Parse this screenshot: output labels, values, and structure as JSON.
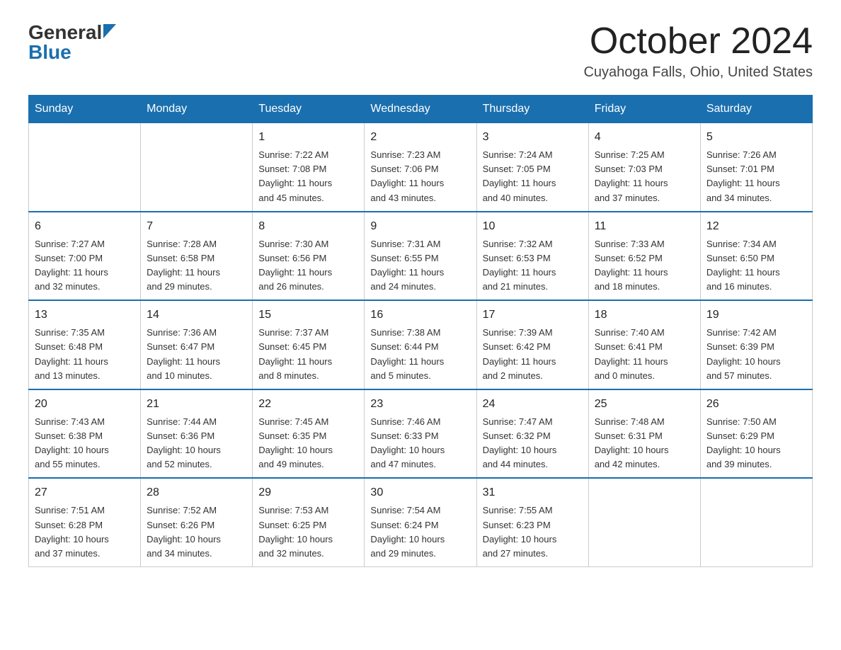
{
  "header": {
    "logo_line1": "General",
    "logo_line2": "Blue",
    "month": "October 2024",
    "location": "Cuyahoga Falls, Ohio, United States"
  },
  "days_of_week": [
    "Sunday",
    "Monday",
    "Tuesday",
    "Wednesday",
    "Thursday",
    "Friday",
    "Saturday"
  ],
  "weeks": [
    [
      {
        "day": "",
        "info": ""
      },
      {
        "day": "",
        "info": ""
      },
      {
        "day": "1",
        "info": "Sunrise: 7:22 AM\nSunset: 7:08 PM\nDaylight: 11 hours\nand 45 minutes."
      },
      {
        "day": "2",
        "info": "Sunrise: 7:23 AM\nSunset: 7:06 PM\nDaylight: 11 hours\nand 43 minutes."
      },
      {
        "day": "3",
        "info": "Sunrise: 7:24 AM\nSunset: 7:05 PM\nDaylight: 11 hours\nand 40 minutes."
      },
      {
        "day": "4",
        "info": "Sunrise: 7:25 AM\nSunset: 7:03 PM\nDaylight: 11 hours\nand 37 minutes."
      },
      {
        "day": "5",
        "info": "Sunrise: 7:26 AM\nSunset: 7:01 PM\nDaylight: 11 hours\nand 34 minutes."
      }
    ],
    [
      {
        "day": "6",
        "info": "Sunrise: 7:27 AM\nSunset: 7:00 PM\nDaylight: 11 hours\nand 32 minutes."
      },
      {
        "day": "7",
        "info": "Sunrise: 7:28 AM\nSunset: 6:58 PM\nDaylight: 11 hours\nand 29 minutes."
      },
      {
        "day": "8",
        "info": "Sunrise: 7:30 AM\nSunset: 6:56 PM\nDaylight: 11 hours\nand 26 minutes."
      },
      {
        "day": "9",
        "info": "Sunrise: 7:31 AM\nSunset: 6:55 PM\nDaylight: 11 hours\nand 24 minutes."
      },
      {
        "day": "10",
        "info": "Sunrise: 7:32 AM\nSunset: 6:53 PM\nDaylight: 11 hours\nand 21 minutes."
      },
      {
        "day": "11",
        "info": "Sunrise: 7:33 AM\nSunset: 6:52 PM\nDaylight: 11 hours\nand 18 minutes."
      },
      {
        "day": "12",
        "info": "Sunrise: 7:34 AM\nSunset: 6:50 PM\nDaylight: 11 hours\nand 16 minutes."
      }
    ],
    [
      {
        "day": "13",
        "info": "Sunrise: 7:35 AM\nSunset: 6:48 PM\nDaylight: 11 hours\nand 13 minutes."
      },
      {
        "day": "14",
        "info": "Sunrise: 7:36 AM\nSunset: 6:47 PM\nDaylight: 11 hours\nand 10 minutes."
      },
      {
        "day": "15",
        "info": "Sunrise: 7:37 AM\nSunset: 6:45 PM\nDaylight: 11 hours\nand 8 minutes."
      },
      {
        "day": "16",
        "info": "Sunrise: 7:38 AM\nSunset: 6:44 PM\nDaylight: 11 hours\nand 5 minutes."
      },
      {
        "day": "17",
        "info": "Sunrise: 7:39 AM\nSunset: 6:42 PM\nDaylight: 11 hours\nand 2 minutes."
      },
      {
        "day": "18",
        "info": "Sunrise: 7:40 AM\nSunset: 6:41 PM\nDaylight: 11 hours\nand 0 minutes."
      },
      {
        "day": "19",
        "info": "Sunrise: 7:42 AM\nSunset: 6:39 PM\nDaylight: 10 hours\nand 57 minutes."
      }
    ],
    [
      {
        "day": "20",
        "info": "Sunrise: 7:43 AM\nSunset: 6:38 PM\nDaylight: 10 hours\nand 55 minutes."
      },
      {
        "day": "21",
        "info": "Sunrise: 7:44 AM\nSunset: 6:36 PM\nDaylight: 10 hours\nand 52 minutes."
      },
      {
        "day": "22",
        "info": "Sunrise: 7:45 AM\nSunset: 6:35 PM\nDaylight: 10 hours\nand 49 minutes."
      },
      {
        "day": "23",
        "info": "Sunrise: 7:46 AM\nSunset: 6:33 PM\nDaylight: 10 hours\nand 47 minutes."
      },
      {
        "day": "24",
        "info": "Sunrise: 7:47 AM\nSunset: 6:32 PM\nDaylight: 10 hours\nand 44 minutes."
      },
      {
        "day": "25",
        "info": "Sunrise: 7:48 AM\nSunset: 6:31 PM\nDaylight: 10 hours\nand 42 minutes."
      },
      {
        "day": "26",
        "info": "Sunrise: 7:50 AM\nSunset: 6:29 PM\nDaylight: 10 hours\nand 39 minutes."
      }
    ],
    [
      {
        "day": "27",
        "info": "Sunrise: 7:51 AM\nSunset: 6:28 PM\nDaylight: 10 hours\nand 37 minutes."
      },
      {
        "day": "28",
        "info": "Sunrise: 7:52 AM\nSunset: 6:26 PM\nDaylight: 10 hours\nand 34 minutes."
      },
      {
        "day": "29",
        "info": "Sunrise: 7:53 AM\nSunset: 6:25 PM\nDaylight: 10 hours\nand 32 minutes."
      },
      {
        "day": "30",
        "info": "Sunrise: 7:54 AM\nSunset: 6:24 PM\nDaylight: 10 hours\nand 29 minutes."
      },
      {
        "day": "31",
        "info": "Sunrise: 7:55 AM\nSunset: 6:23 PM\nDaylight: 10 hours\nand 27 minutes."
      },
      {
        "day": "",
        "info": ""
      },
      {
        "day": "",
        "info": ""
      }
    ]
  ]
}
